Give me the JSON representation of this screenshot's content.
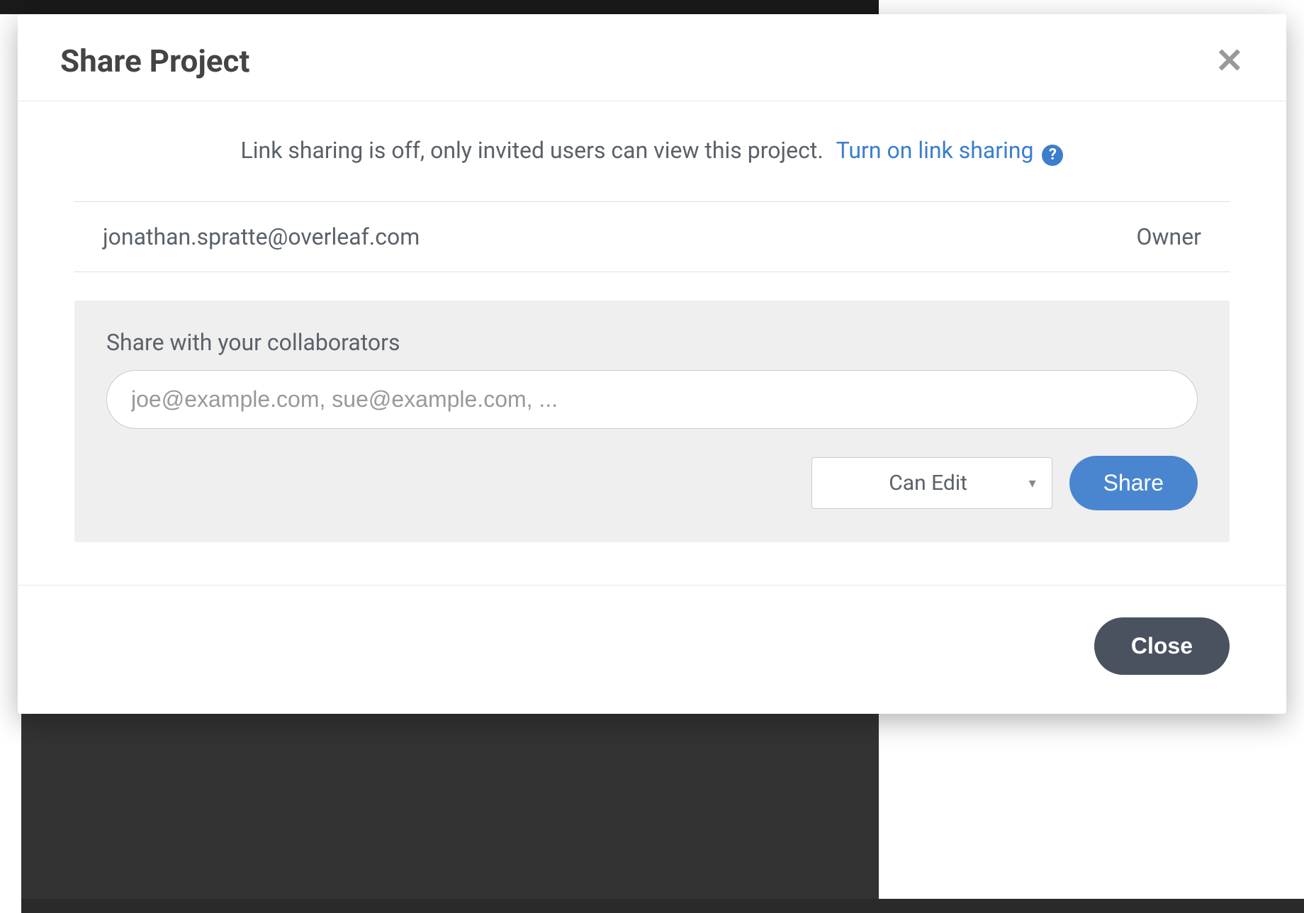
{
  "modal": {
    "title": "Share Project",
    "link_sharing": {
      "status_text": "Link sharing is off, only invited users can view this project.",
      "action_text": "Turn on link sharing",
      "help_icon_label": "?"
    },
    "owner": {
      "email": "jonathan.spratte@overleaf.com",
      "role": "Owner"
    },
    "share_form": {
      "label": "Share with your collaborators",
      "placeholder": "joe@example.com, sue@example.com, ...",
      "permission_selected": "Can Edit",
      "share_button_label": "Share"
    },
    "close_button_label": "Close"
  }
}
